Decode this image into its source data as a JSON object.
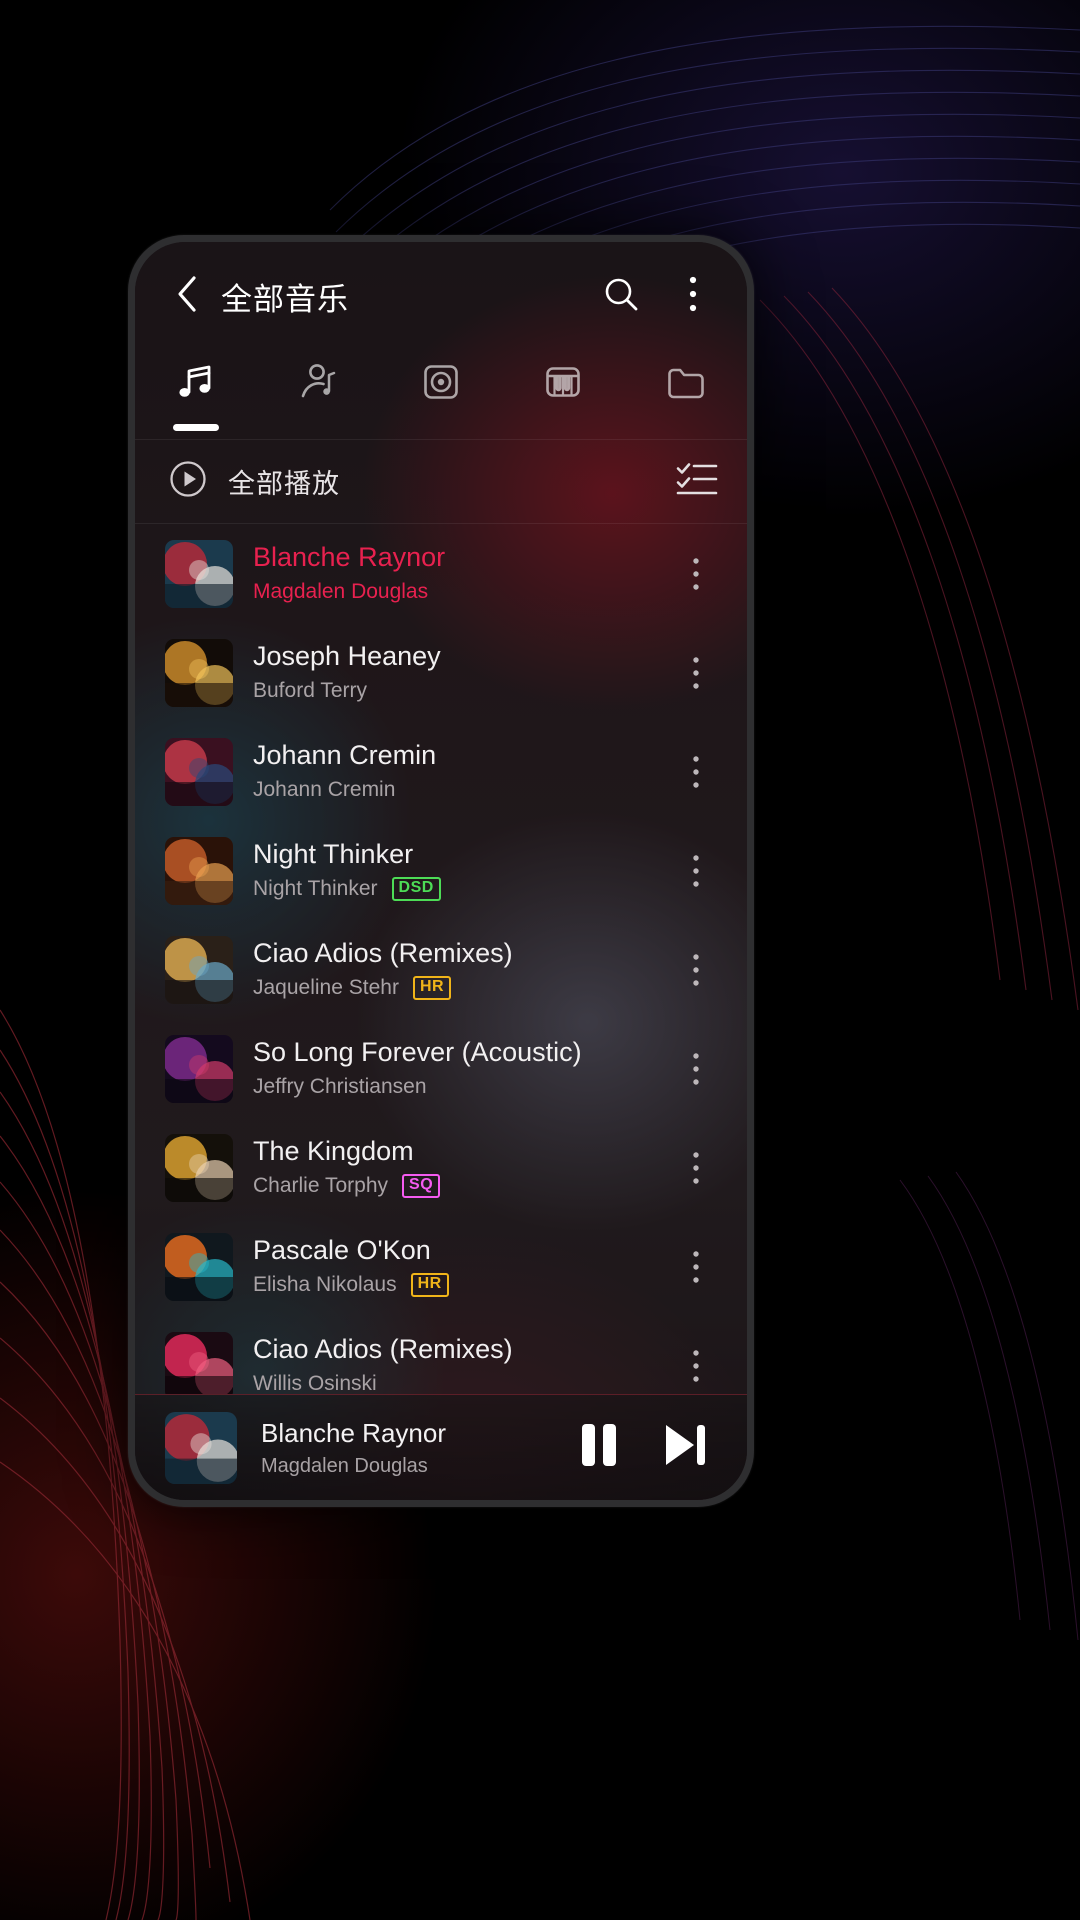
{
  "header": {
    "title": "全部音乐",
    "back_icon": "chevron-left-icon",
    "search_icon": "search-icon",
    "overflow_icon": "more-vertical-icon"
  },
  "tabs": [
    {
      "name": "songs",
      "icon": "music-note-icon",
      "active": true
    },
    {
      "name": "artists",
      "icon": "artist-icon",
      "active": false
    },
    {
      "name": "albums",
      "icon": "album-disc-icon",
      "active": false
    },
    {
      "name": "genres",
      "icon": "piano-keys-icon",
      "active": false
    },
    {
      "name": "folders",
      "icon": "folder-icon",
      "active": false
    }
  ],
  "play_all": {
    "label": "全部播放",
    "play_icon": "play-circle-icon",
    "select_icon": "checklist-icon"
  },
  "songs": [
    {
      "title": "Blanche Raynor",
      "artist": "Magdalen Douglas",
      "badge": "",
      "playing": true,
      "art": "a"
    },
    {
      "title": "Joseph Heaney",
      "artist": "Buford Terry",
      "badge": "",
      "playing": false,
      "art": "b"
    },
    {
      "title": "Johann Cremin",
      "artist": "Johann Cremin",
      "badge": "",
      "playing": false,
      "art": "c"
    },
    {
      "title": "Night Thinker",
      "artist": "Night Thinker",
      "badge": "DSD",
      "playing": false,
      "art": "d"
    },
    {
      "title": "Ciao Adios (Remixes)",
      "artist": "Jaqueline Stehr",
      "badge": "HR",
      "playing": false,
      "art": "e"
    },
    {
      "title": "So Long Forever (Acoustic)",
      "artist": "Jeffry Christiansen",
      "badge": "",
      "playing": false,
      "art": "f"
    },
    {
      "title": "The Kingdom",
      "artist": "Charlie Torphy",
      "badge": "SQ",
      "playing": false,
      "art": "g"
    },
    {
      "title": "Pascale O'Kon",
      "artist": "Elisha Nikolaus",
      "badge": "HR",
      "playing": false,
      "art": "h"
    },
    {
      "title": "Ciao Adios (Remixes)",
      "artist": "Willis Osinski",
      "badge": "",
      "playing": false,
      "art": "i"
    }
  ],
  "now_playing": {
    "title": "Blanche Raynor",
    "artist": "Magdalen Douglas",
    "pause_icon": "pause-icon",
    "next_icon": "skip-next-icon",
    "art": "a"
  },
  "colors": {
    "accent": "#e8214f",
    "badge_dsd": "#4ddc56",
    "badge_hr": "#f0b419",
    "badge_sq": "#f55bf0",
    "title_text": "#f2f0f1",
    "subtitle_text": "#a9a3a6"
  }
}
